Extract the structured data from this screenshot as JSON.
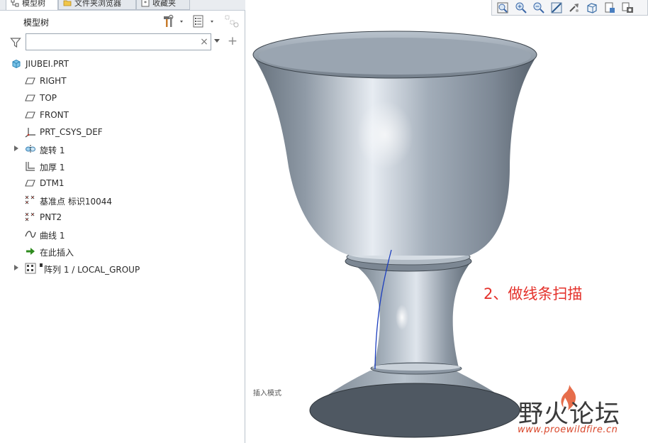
{
  "tabs": [
    {
      "label": "模型树",
      "icon": "model-tree-icon"
    },
    {
      "label": "文件夹浏览器",
      "icon": "folder-icon"
    },
    {
      "label": "收藏夹",
      "icon": "favorites-icon"
    }
  ],
  "tree_header": {
    "title": "模型树"
  },
  "search": {
    "value": "",
    "placeholder": ""
  },
  "tree": {
    "root": "JIUBEI.PRT",
    "items": [
      {
        "label": "RIGHT",
        "icon": "datum-plane-icon"
      },
      {
        "label": "TOP",
        "icon": "datum-plane-icon"
      },
      {
        "label": "FRONT",
        "icon": "datum-plane-icon"
      },
      {
        "label": "PRT_CSYS_DEF",
        "icon": "coordinate-system-icon"
      },
      {
        "label": "旋转 1",
        "icon": "revolve-icon",
        "expandable": true
      },
      {
        "label": "加厚 1",
        "icon": "thicken-icon"
      },
      {
        "label": "DTM1",
        "icon": "datum-plane-icon"
      },
      {
        "label": "基准点 标识10044",
        "icon": "datum-point-icon"
      },
      {
        "label": "PNT2",
        "icon": "datum-point-icon"
      },
      {
        "label": "曲线 1",
        "icon": "curve-icon"
      },
      {
        "label": "在此插入",
        "icon": "insert-here-arrow-icon"
      },
      {
        "label": "阵列 1 / LOCAL_GROUP",
        "icon": "pattern-icon",
        "expandable": true
      }
    ]
  },
  "viewport": {
    "annotation": "2、做线条扫描",
    "insert_mode_label": "插入模式"
  },
  "watermark": {
    "name": "野火论坛",
    "url": "www.proewildfire.cn"
  },
  "colors": {
    "accent_red": "#e4312b",
    "model_gray": "#8e9aa6",
    "curve_blue": "#1d3fbf"
  }
}
